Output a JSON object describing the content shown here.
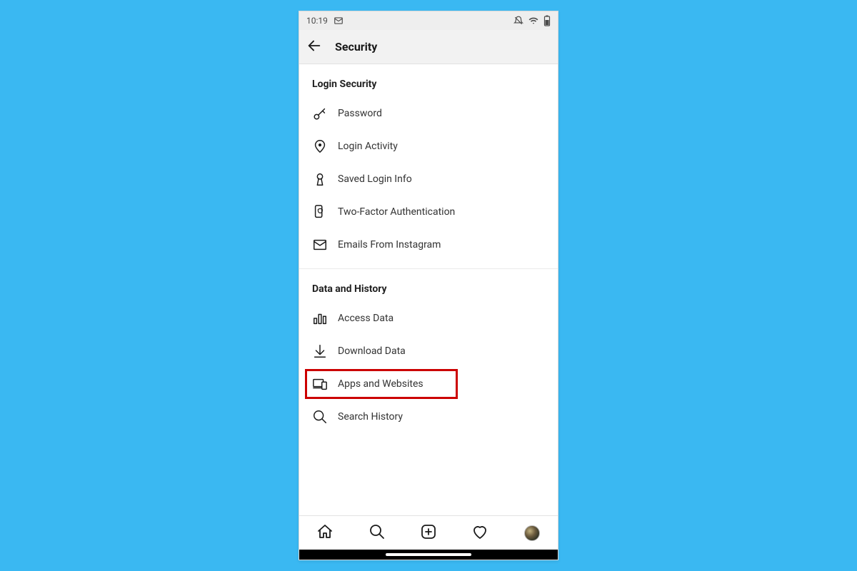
{
  "statusbar": {
    "time": "10:19"
  },
  "appbar": {
    "title": "Security"
  },
  "sections": [
    {
      "title": "Login Security",
      "items": [
        {
          "label": "Password"
        },
        {
          "label": "Login Activity"
        },
        {
          "label": "Saved Login Info"
        },
        {
          "label": "Two-Factor Authentication"
        },
        {
          "label": "Emails From Instagram"
        }
      ]
    },
    {
      "title": "Data and History",
      "items": [
        {
          "label": "Access Data"
        },
        {
          "label": "Download Data"
        },
        {
          "label": "Apps and Websites"
        },
        {
          "label": "Search History"
        }
      ]
    }
  ],
  "highlight": {
    "color": "#cc0000"
  }
}
